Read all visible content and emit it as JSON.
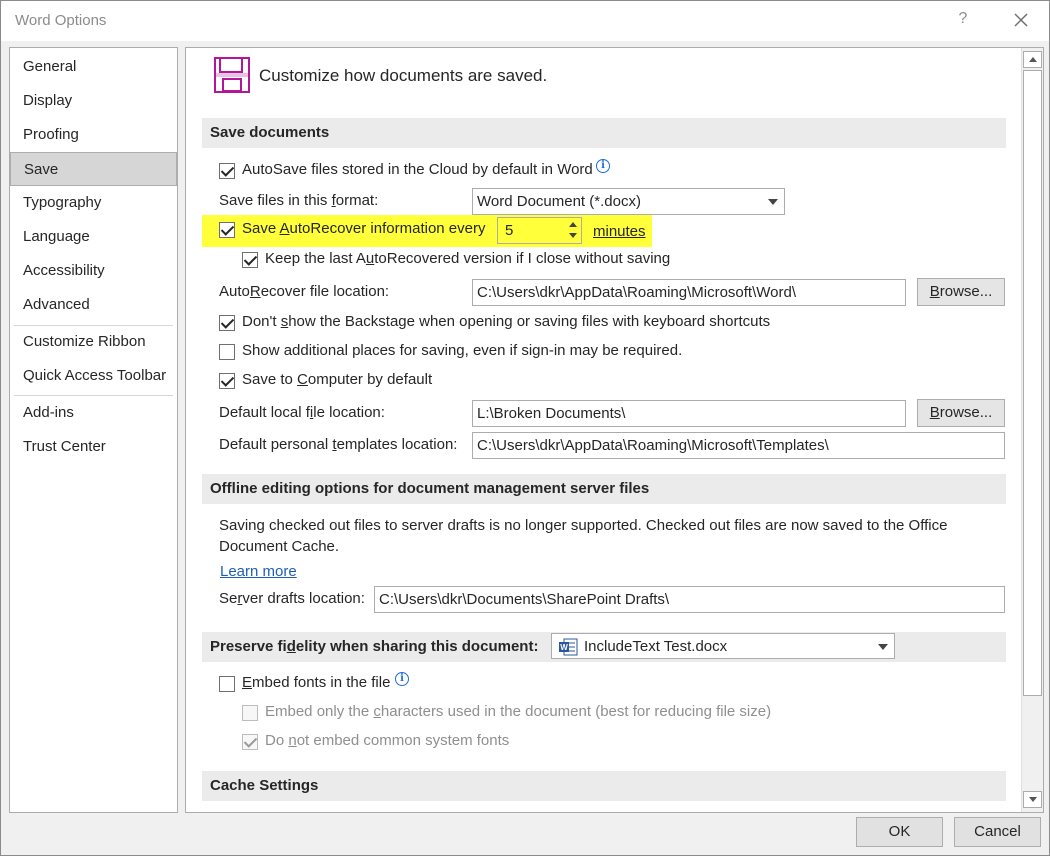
{
  "window": {
    "title": "Word Options",
    "help": "?"
  },
  "sidebar": {
    "items": [
      {
        "label": "General"
      },
      {
        "label": "Display"
      },
      {
        "label": "Proofing"
      },
      {
        "label": "Save"
      },
      {
        "label": "Typography"
      },
      {
        "label": "Language"
      },
      {
        "label": "Accessibility"
      },
      {
        "label": "Advanced"
      },
      {
        "label": "Customize Ribbon"
      },
      {
        "label": "Quick Access Toolbar"
      },
      {
        "label": "Add-ins"
      },
      {
        "label": "Trust Center"
      }
    ],
    "active": "Save"
  },
  "main": {
    "header": "Customize how documents are saved.",
    "save_documents": {
      "title": "Save documents",
      "autosave_label": "AutoSave files stored in the Cloud by default in Word",
      "autosave_checked": true,
      "format_label_pre": "Save files in this ",
      "format_label_u": "f",
      "format_label_post": "ormat:",
      "format_value": "Word Document (*.docx)",
      "autorecover_pre": "Save ",
      "autorecover_u": "A",
      "autorecover_post": "utoRecover information every",
      "autorecover_checked": true,
      "autorecover_minutes": "5",
      "minutes_label": "minutes",
      "keep_last_pre": "Keep the last A",
      "keep_last_u": "u",
      "keep_last_post": "toRecovered version if I close without saving",
      "keep_last_checked": true,
      "ar_location_pre": "Auto",
      "ar_location_u": "R",
      "ar_location_post": "ecover file location:",
      "ar_location_value": "C:\\Users\\dkr\\AppData\\Roaming\\Microsoft\\Word\\",
      "browse_pre": "",
      "browse_u": "B",
      "browse_post": "rowse...",
      "no_backstage_pre": "Don't ",
      "no_backstage_u": "s",
      "no_backstage_post": "how the Backstage when opening or saving files with keyboard shortcuts",
      "no_backstage_checked": true,
      "additional_places": "Show additional places for saving, even if sign-in may be required.",
      "additional_places_checked": false,
      "save_computer_pre": "Save to ",
      "save_computer_u": "C",
      "save_computer_post": "omputer by default",
      "save_computer_checked": true,
      "default_local_pre": "Default local f",
      "default_local_u": "i",
      "default_local_post": "le location:",
      "default_local_value": "L:\\Broken Documents\\",
      "templates_pre": "Default personal ",
      "templates_u": "t",
      "templates_post": "emplates location:",
      "templates_value": "C:\\Users\\dkr\\AppData\\Roaming\\Microsoft\\Templates\\"
    },
    "offline": {
      "title": "Offline editing options for document management server files",
      "notice_line1": "Saving checked out files to server drafts is no longer supported. Checked out files are now saved to the Office",
      "notice_line2": "Document Cache.",
      "learn_more": "Learn more",
      "drafts_pre": "Se",
      "drafts_u": "r",
      "drafts_post": "ver drafts location:",
      "drafts_value": "C:\\Users\\dkr\\Documents\\SharePoint Drafts\\"
    },
    "fidelity": {
      "title_pre": "Preserve fi",
      "title_u": "d",
      "title_post": "elity when sharing this document:",
      "document_value": "IncludeText Test.docx",
      "embed_pre": "",
      "embed_u": "E",
      "embed_post": "mbed fonts in the file",
      "embed_checked": false,
      "embed_only_pre": "Embed only the ",
      "embed_only_u": "c",
      "embed_only_post": "haracters used in the document (best for reducing file size)",
      "embed_only_checked": false,
      "no_common_pre": "Do ",
      "no_common_u": "n",
      "no_common_post": "ot embed common system fonts",
      "no_common_checked": true
    },
    "cache": {
      "title": "Cache Settings"
    }
  },
  "footer": {
    "ok": "OK",
    "cancel": "Cancel"
  },
  "colors": {
    "highlight": "#ffff3a",
    "accent_purple": "#b4169b",
    "link": "#1e5fb4",
    "info": "#1f6ed4"
  }
}
